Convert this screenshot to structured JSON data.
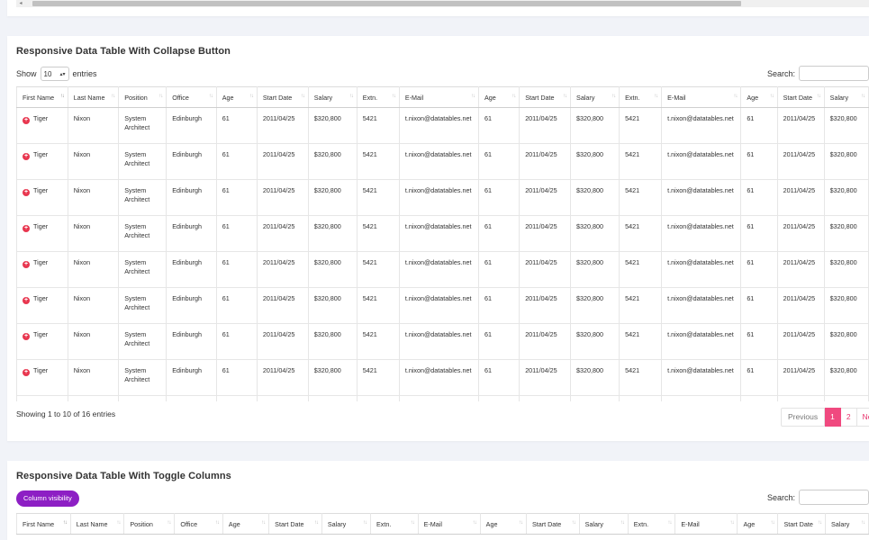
{
  "card1": {
    "title": "Responsive Data Table With Collapse Button",
    "show_label": "Show",
    "length_value": "10",
    "entries_label": "entries",
    "search_label": "Search:",
    "info": "Showing 1 to 10 of 16 entries",
    "pagination": {
      "previous": "Previous",
      "pages": [
        "1",
        "2"
      ],
      "next": "Next"
    }
  },
  "card2": {
    "title": "Responsive Data Table With Toggle Columns",
    "colvis_label": "Column visibility",
    "search_label": "Search:"
  },
  "columns": [
    "First Name",
    "Last Name",
    "Position",
    "Office",
    "Age",
    "Start Date",
    "Salary",
    "Extn.",
    "E-Mail",
    "Age",
    "Start Date",
    "Salary",
    "Extn.",
    "E-Mail",
    "Age",
    "Start Date",
    "Salary"
  ],
  "row": [
    "Tiger",
    "Nixon",
    "System Architect",
    "Edinburgh",
    "61",
    "2011/04/25",
    "$320,800",
    "5421",
    "t.nixon@datatables.net",
    "61",
    "2011/04/25",
    "$320,800",
    "5421",
    "t.nixon@datatables.net",
    "61",
    "2011/04/25",
    "$320,800"
  ],
  "rows_count": 10,
  "colors": {
    "accent": "#f0497f",
    "control": "#e8364f",
    "button": "#8d1fc4"
  }
}
